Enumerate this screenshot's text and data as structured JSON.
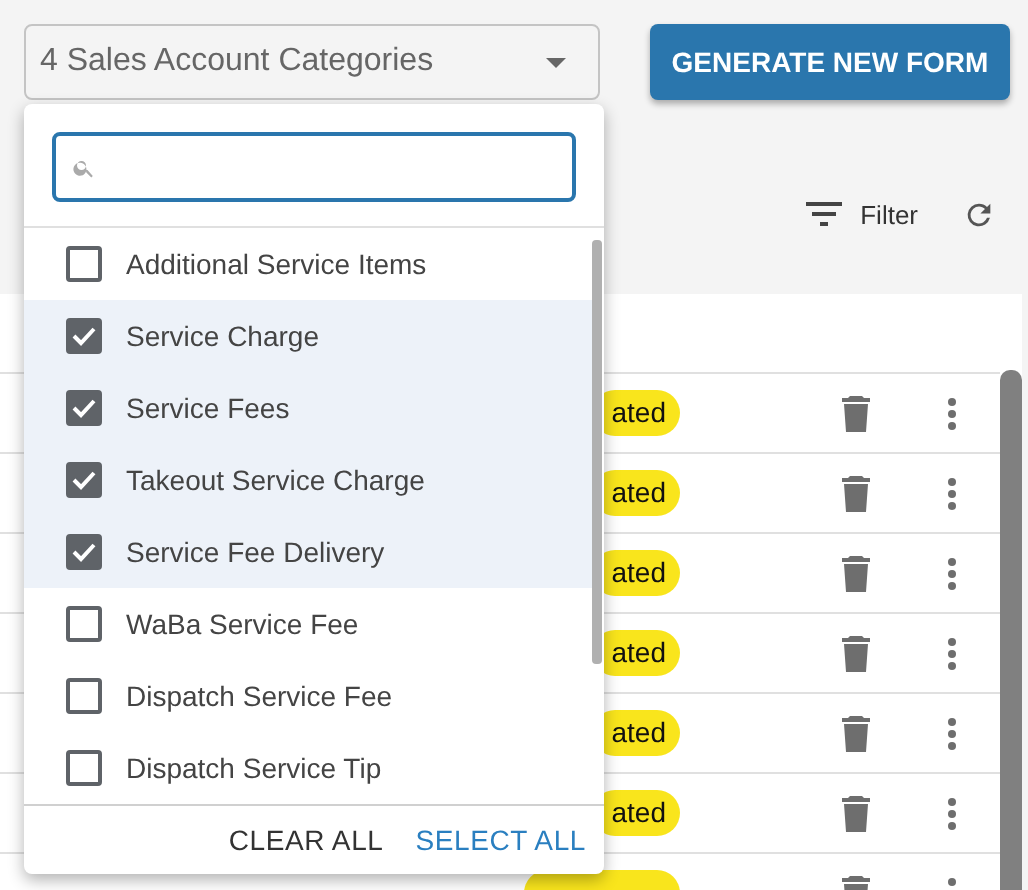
{
  "category_select": {
    "value": "4 Sales Account Categories"
  },
  "generate_button": {
    "label": "GENERATE NEW FORM"
  },
  "toolbar": {
    "filter_label": "Filter"
  },
  "dropdown": {
    "items": [
      {
        "label": "Additional Service Items",
        "checked": false
      },
      {
        "label": "Service Charge",
        "checked": true
      },
      {
        "label": "Service Fees",
        "checked": true
      },
      {
        "label": "Takeout Service Charge",
        "checked": true
      },
      {
        "label": "Service Fee Delivery",
        "checked": true
      },
      {
        "label": "WaBa Service Fee",
        "checked": false
      },
      {
        "label": "Dispatch Service Fee",
        "checked": false
      },
      {
        "label": "Dispatch Service Tip",
        "checked": false
      }
    ],
    "actions": [
      {
        "label": "CLEAR ALL",
        "kind": "secondary"
      },
      {
        "label": "SELECT ALL",
        "kind": "primary"
      }
    ]
  },
  "table": {
    "rows": [
      {
        "status": "ated"
      },
      {
        "status": "ated"
      },
      {
        "status": "ated"
      },
      {
        "status": "ated"
      },
      {
        "status": "ated"
      },
      {
        "status": "ated"
      },
      {}
    ]
  }
}
